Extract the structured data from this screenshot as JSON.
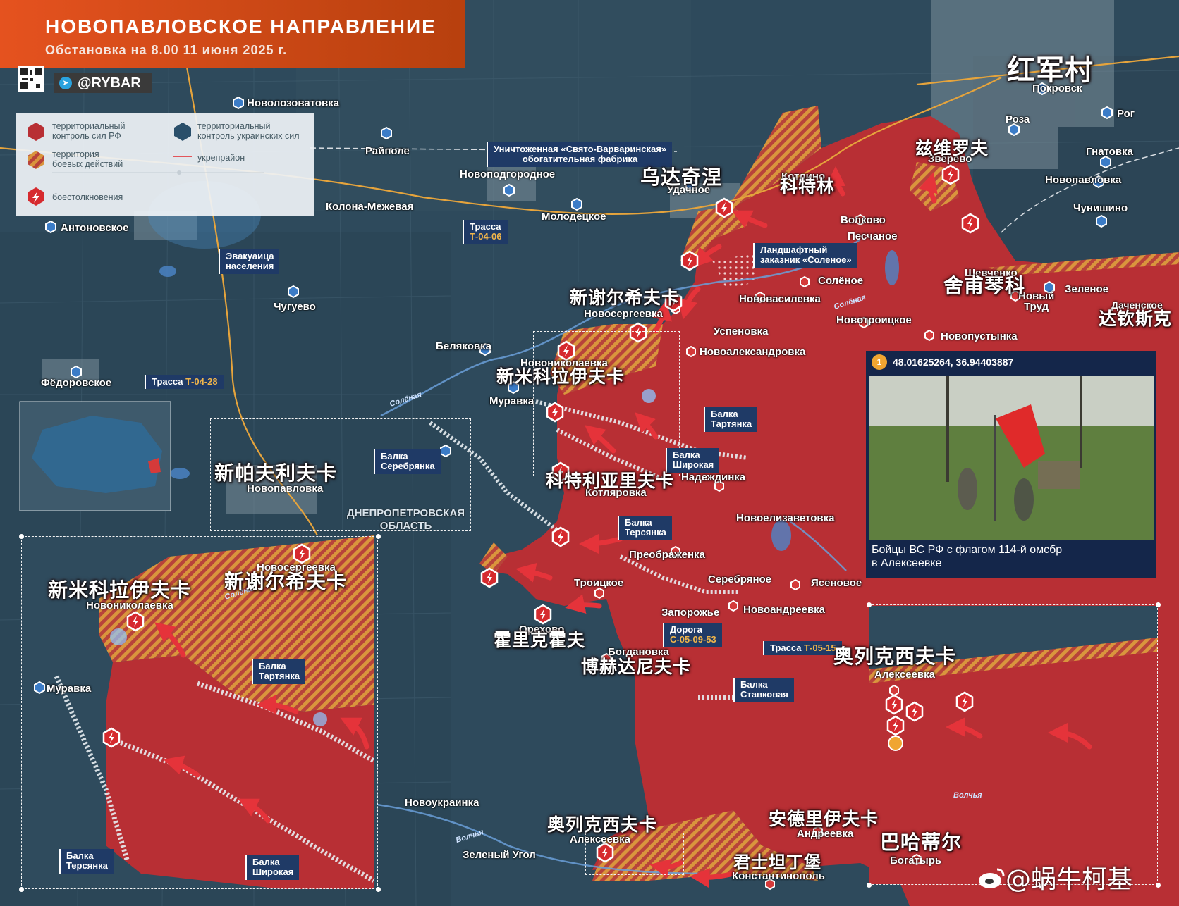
{
  "header": {
    "title": "НОВОПАВЛОВСКОЕ НАПРАВЛЕНИЕ",
    "subtitle": "Обстановка на 8.00 11 июня 2025 г.",
    "brand": "@RYBAR"
  },
  "legend": {
    "ru_control": "территориальный\nконтроль сил РФ",
    "ua_control": "территориальный\nконтроль украинских сил",
    "combat_zone": "территория\nбоевых действий",
    "fortifications": "укрепрайон",
    "clashes": "боестолкновения"
  },
  "colors": {
    "ru_control": "#b82f34",
    "ua_control": "#2a4f6a",
    "combat_zone": "#e0953a",
    "header": "#e5521f",
    "road": "#e6a43c"
  },
  "places": {
    "novolozovatovka": "Новолозоватовка",
    "raipole": "Райполе",
    "novopodgorodnoe": "Новоподгородное",
    "kolona_mezhevaya": "Колона-Межевая",
    "antonovskoe": "Антоновское",
    "molodetskoe": "Молодецкое",
    "udachnoe": "Удачное",
    "kotlino": "Котлино",
    "volkovo": "Волково",
    "peschanoe": "Песчаное",
    "zverevo": "Зверево",
    "pokrovsk": "Покровск",
    "roza": "Роза",
    "rog": "Рог",
    "gnatovka": "Гнатовка",
    "novopavlovka_n": "Новопавловка",
    "chunishino": "Чунишино",
    "shevchenko": "Шевченко",
    "novy_trud": "Новый\nТруд",
    "zelenoe": "Зеленое",
    "dachenskoe": "Даченское",
    "chuguevo": "Чугуево",
    "novosergeevka": "Новосергеевка",
    "novovasilevka": "Нововасилевка",
    "solenoe": "Солёное",
    "uspenovka": "Успеновка",
    "novotroitskoe": "Новотроицкое",
    "novopustynka": "Новопустынка",
    "novoaleksandrovka": "Новоалександровка",
    "belyakovka": "Беляковка",
    "fedorovskoe": "Фёдоровское",
    "novonikolaevka": "Новониколаевка",
    "muravka": "Муравка",
    "novopavlovka": "Новопавловка",
    "nadezhdinka": "Надеждинка",
    "kotlyarovka": "Котляровка",
    "novoelizavetovka": "Новоелизаветовка",
    "preobrazhenka": "Преображенка",
    "troitskoe": "Троицкое",
    "serebryanoe": "Серебряное",
    "yasenovoe": "Ясеновое",
    "zaporozhe": "Запорожье",
    "novoandreevka": "Новоандреевка",
    "orekhovo": "Орехово",
    "bogdanovka": "Богдановка",
    "novoukrainka": "Новоукраинка",
    "alekseevka": "Алексеевка",
    "zeleny_ugol": "Зеленый Угол",
    "konstantinopol": "Константинополь",
    "andreevka": "Андреевка",
    "bogatyr": "Богатырь"
  },
  "boxes": {
    "factory": "Уничтоженная «Свято-Варваринская»\nобогатительная фабрика",
    "t0406_a": "Трасса",
    "t0406_b": "Т-04-06",
    "reserve": "Ландшафтный\nзаказник «Соленое»",
    "evac": "Эвакуаица\nнаселения",
    "t0428_a": "Трасса ",
    "t0428_b": "Т-04-28",
    "tartyanka": "Балка\nТартянка",
    "shirokaya": "Балка\nШирокая",
    "serebryanka": "Балка\nСеребрянка",
    "tersyanka": "Балка\nТерсянка",
    "road_a": "Дорога",
    "road_b": "С-05-09-53",
    "t0515_a": "Трасса ",
    "t0515_b": "Т-05-15",
    "stavkovaya": "Балка\nСтавковая"
  },
  "rivers": {
    "solenaya": "Солёная",
    "volcha": "Волчья"
  },
  "region": "ДНЕПРОПЕТРОВСКАЯ\nОБЛАСТЬ",
  "chinese": {
    "hongjuncun": "红军村",
    "ziweiluofu": "兹维罗夫",
    "udaqinie": "乌达奇涅",
    "kotelin": "科特林",
    "xinxieer": "新谢尔希夫卡",
    "shefuqinke": "舍甫琴科",
    "daqinsike": "达钦斯克",
    "xinmikelayifuka": "新米科拉伊夫卡",
    "xinpafulifuka": "新帕夫利夫卡",
    "ketelilialifuka": "科特利亚里夫卡",
    "huolikehuofu": "霍里克霍夫",
    "bohedaniefuka": "博赫达尼夫卡",
    "aoliekexifuka": "奥列克西夫卡",
    "andeliyifuka": "安德里伊夫卡",
    "junshitandingbao": "君士坦丁堡",
    "bahadier": "巴哈蒂尔"
  },
  "photo": {
    "marker": "1",
    "coords": "48.01625264, 36.94403887",
    "caption": "Бойцы ВС РФ с флагом 114-й омсбр\nв Алексеевке"
  },
  "watermark": "@蜗牛柯基"
}
